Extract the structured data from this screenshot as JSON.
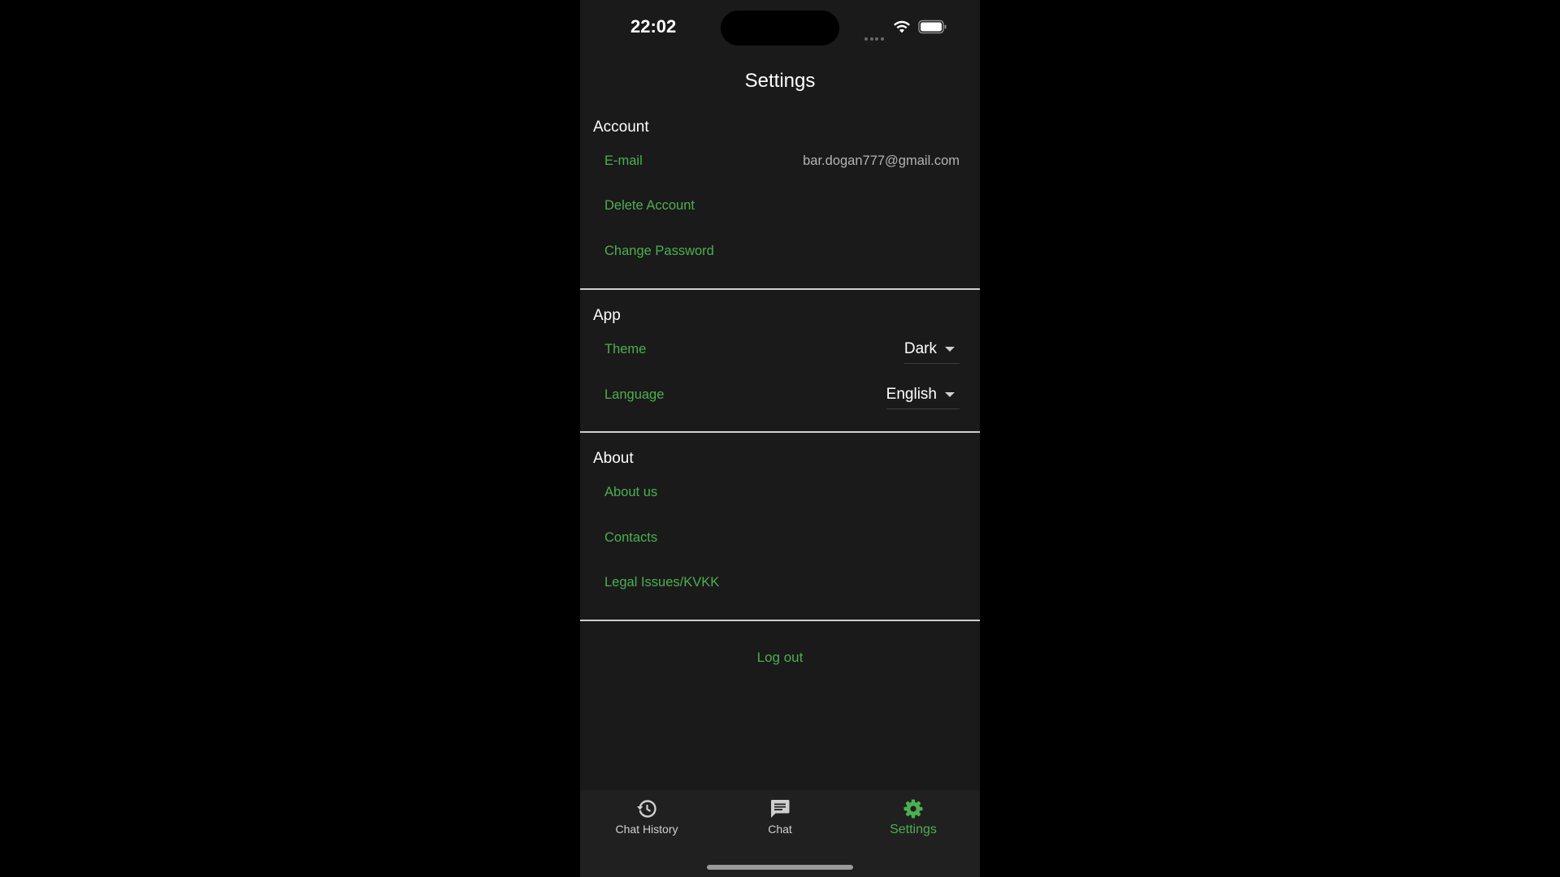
{
  "status_bar": {
    "time": "22:02",
    "icons": [
      "signal-icon",
      "wifi-icon",
      "battery-icon"
    ]
  },
  "header": {
    "title": "Settings"
  },
  "sections": {
    "account": {
      "title": "Account",
      "email_label": "E-mail",
      "email_value": "bar.dogan777@gmail.com",
      "delete_account": "Delete Account",
      "change_password": "Change Password"
    },
    "app": {
      "title": "App",
      "theme_label": "Theme",
      "theme_value": "Dark",
      "language_label": "Language",
      "language_value": "English"
    },
    "about": {
      "title": "About",
      "about_us": "About us",
      "contacts": "Contacts",
      "legal": "Legal Issues/KVKK"
    }
  },
  "logout_label": "Log out",
  "bottom_nav": {
    "items": [
      {
        "label": "Chat History",
        "icon": "history-icon"
      },
      {
        "label": "Chat",
        "icon": "chat-icon"
      },
      {
        "label": "Settings",
        "icon": "gear-icon",
        "active": true
      }
    ]
  },
  "colors": {
    "accent": "#4caf50",
    "background": "#1a1a1a",
    "nav_background": "#202020"
  }
}
